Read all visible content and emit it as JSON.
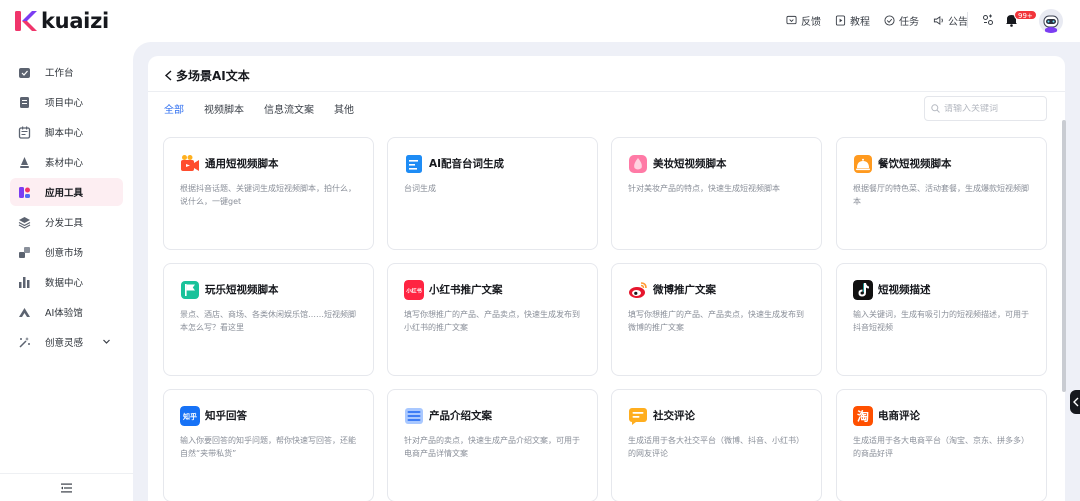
{
  "brand": {
    "name": "kuaizi"
  },
  "header": {
    "links": [
      {
        "label": "反馈",
        "icon": "feedback-icon"
      },
      {
        "label": "教程",
        "icon": "tutorial-icon"
      },
      {
        "label": "任务",
        "icon": "task-icon"
      },
      {
        "label": "公告",
        "icon": "announcement-icon"
      }
    ],
    "notification_badge": "99+"
  },
  "sidebar": {
    "items": [
      {
        "label": "工作台",
        "icon": "dashboard-icon"
      },
      {
        "label": "项目中心",
        "icon": "project-icon"
      },
      {
        "label": "脚本中心",
        "icon": "script-icon"
      },
      {
        "label": "素材中心",
        "icon": "material-icon"
      },
      {
        "label": "应用工具",
        "icon": "app-tools-icon",
        "active": true
      },
      {
        "label": "分发工具",
        "icon": "distribute-icon"
      },
      {
        "label": "创意市场",
        "icon": "market-icon"
      },
      {
        "label": "数据中心",
        "icon": "data-icon"
      },
      {
        "label": "AI体验馆",
        "icon": "ai-icon"
      },
      {
        "label": "创意灵感",
        "icon": "inspiration-icon",
        "expandable": true
      }
    ]
  },
  "page": {
    "title": "多场景AI文本",
    "tabs": [
      {
        "label": "全部",
        "active": true
      },
      {
        "label": "视频脚本"
      },
      {
        "label": "信息流文案"
      },
      {
        "label": "其他"
      }
    ],
    "search_placeholder": "请输入关键词"
  },
  "cards": [
    {
      "title": "通用短视频脚本",
      "desc": "根据抖音话题、关键词生成短视频脚本，拍什么，说什么，一键get",
      "icon": "video-camera-icon"
    },
    {
      "title": "AI配音台词生成",
      "desc": "台词生成",
      "icon": "document-icon"
    },
    {
      "title": "美妆短视频脚本",
      "desc": "针对美妆产品的特点，快速生成短视频脚本",
      "icon": "cosmetics-icon"
    },
    {
      "title": "餐饮短视频脚本",
      "desc": "根据餐厅的特色菜、活动套餐，生成爆款短视频脚本",
      "icon": "dining-icon"
    },
    {
      "title": "玩乐短视频脚本",
      "desc": "景点、酒店、商场、各类休闲娱乐馆……短视频脚本怎么写？看这里",
      "icon": "flag-icon"
    },
    {
      "title": "小红书推广文案",
      "desc": "填写你想推广的产品、产品卖点，快速生成发布到小红书的推广文案",
      "icon": "xiaohongshu-icon",
      "badge": "小红书"
    },
    {
      "title": "微博推广文案",
      "desc": "填写你想推广的产品、产品卖点，快速生成发布到微博的推广文案",
      "icon": "weibo-icon"
    },
    {
      "title": "短视频描述",
      "desc": "输入关键词，生成有吸引力的短视频描述，可用于抖音短视频",
      "icon": "tiktok-icon"
    },
    {
      "title": "知乎回答",
      "desc": "输入你要回答的知乎问题，帮你快速写回答，还能自然“夹带私货”",
      "icon": "zhihu-icon",
      "badge": "知乎"
    },
    {
      "title": "产品介绍文案",
      "desc": "针对产品的卖点，快速生成产品介绍文案，可用于电商产品详情文案",
      "icon": "product-list-icon"
    },
    {
      "title": "社交评论",
      "desc": "生成适用于各大社交平台（微博、抖音、小红书）的网友评论",
      "icon": "comment-icon"
    },
    {
      "title": "电商评论",
      "desc": "生成适用于各大电商平台（淘宝、京东、拼多多）的商品好评",
      "icon": "taobao-icon",
      "badge": "淘"
    }
  ],
  "colors": {
    "accent": "#2f6ff0",
    "brand_pink": "#f0356b",
    "active_bg": "#fdeef2",
    "main_bg": "#eef0f7"
  }
}
